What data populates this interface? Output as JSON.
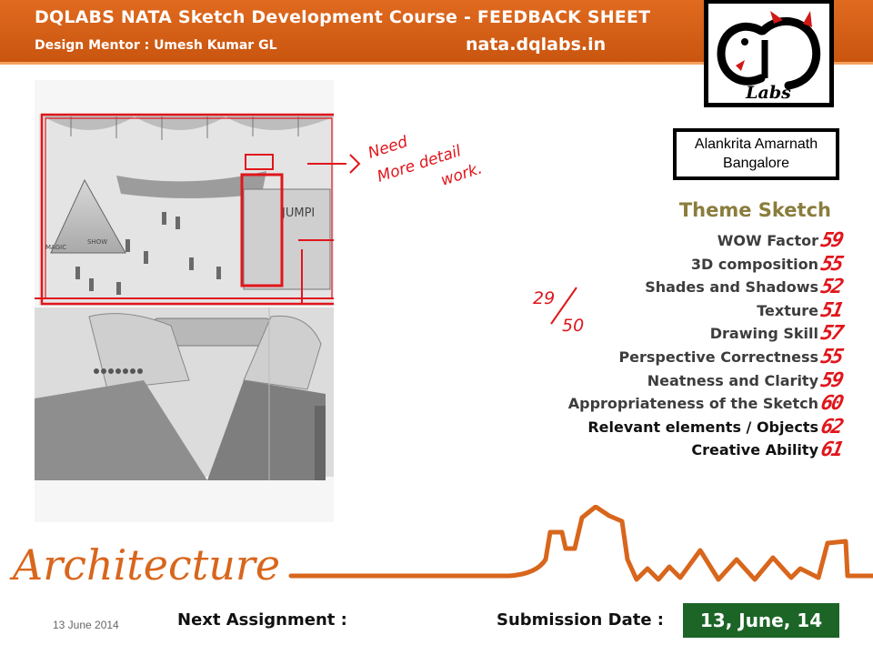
{
  "header": {
    "title": "DQLABS   NATA  Sketch Development Course  - FEEDBACK SHEET",
    "mentor": "Design Mentor :  Umesh Kumar GL",
    "url": "nata.dqlabs.in"
  },
  "logo": {
    "text": "Labs"
  },
  "student": {
    "name": "Alankrita Amarnath",
    "city": "Bangalore"
  },
  "sketch": {
    "signs": [
      "JUMPI",
      "MAGIC",
      "SHOW"
    ]
  },
  "annotation": {
    "line1": "Need",
    "line2": "More detail",
    "line3": "work."
  },
  "total_score": {
    "obtained": "29",
    "out_of": "50"
  },
  "theme": {
    "title": "Theme Sketch",
    "criteria": [
      {
        "label": "WOW Factor",
        "score": "59"
      },
      {
        "label": "3D composition",
        "score": "55"
      },
      {
        "label": "Shades and Shadows",
        "score": "52"
      },
      {
        "label": "Texture",
        "score": "51"
      },
      {
        "label": "Drawing Skill",
        "score": "57"
      },
      {
        "label": "Perspective Correctness",
        "score": "55"
      },
      {
        "label": "Neatness and Clarity",
        "score": "59"
      },
      {
        "label": "Appropriateness  of the Sketch",
        "score": "60"
      },
      {
        "label": "Relevant elements / Objects",
        "score": "62"
      },
      {
        "label": "Creative Ability",
        "score": "61"
      }
    ]
  },
  "footer": {
    "date": "13 June 2014",
    "next_assignment": "Next Assignment  :",
    "submission_label": "Submission Date  :",
    "submission_date": "13, June, 14",
    "deco_word": "Architecture"
  },
  "colors": {
    "header": "#d5601a",
    "accent_red": "#e0161c",
    "submission_bg": "#1c6527",
    "theme_title": "#8a7d3d"
  }
}
